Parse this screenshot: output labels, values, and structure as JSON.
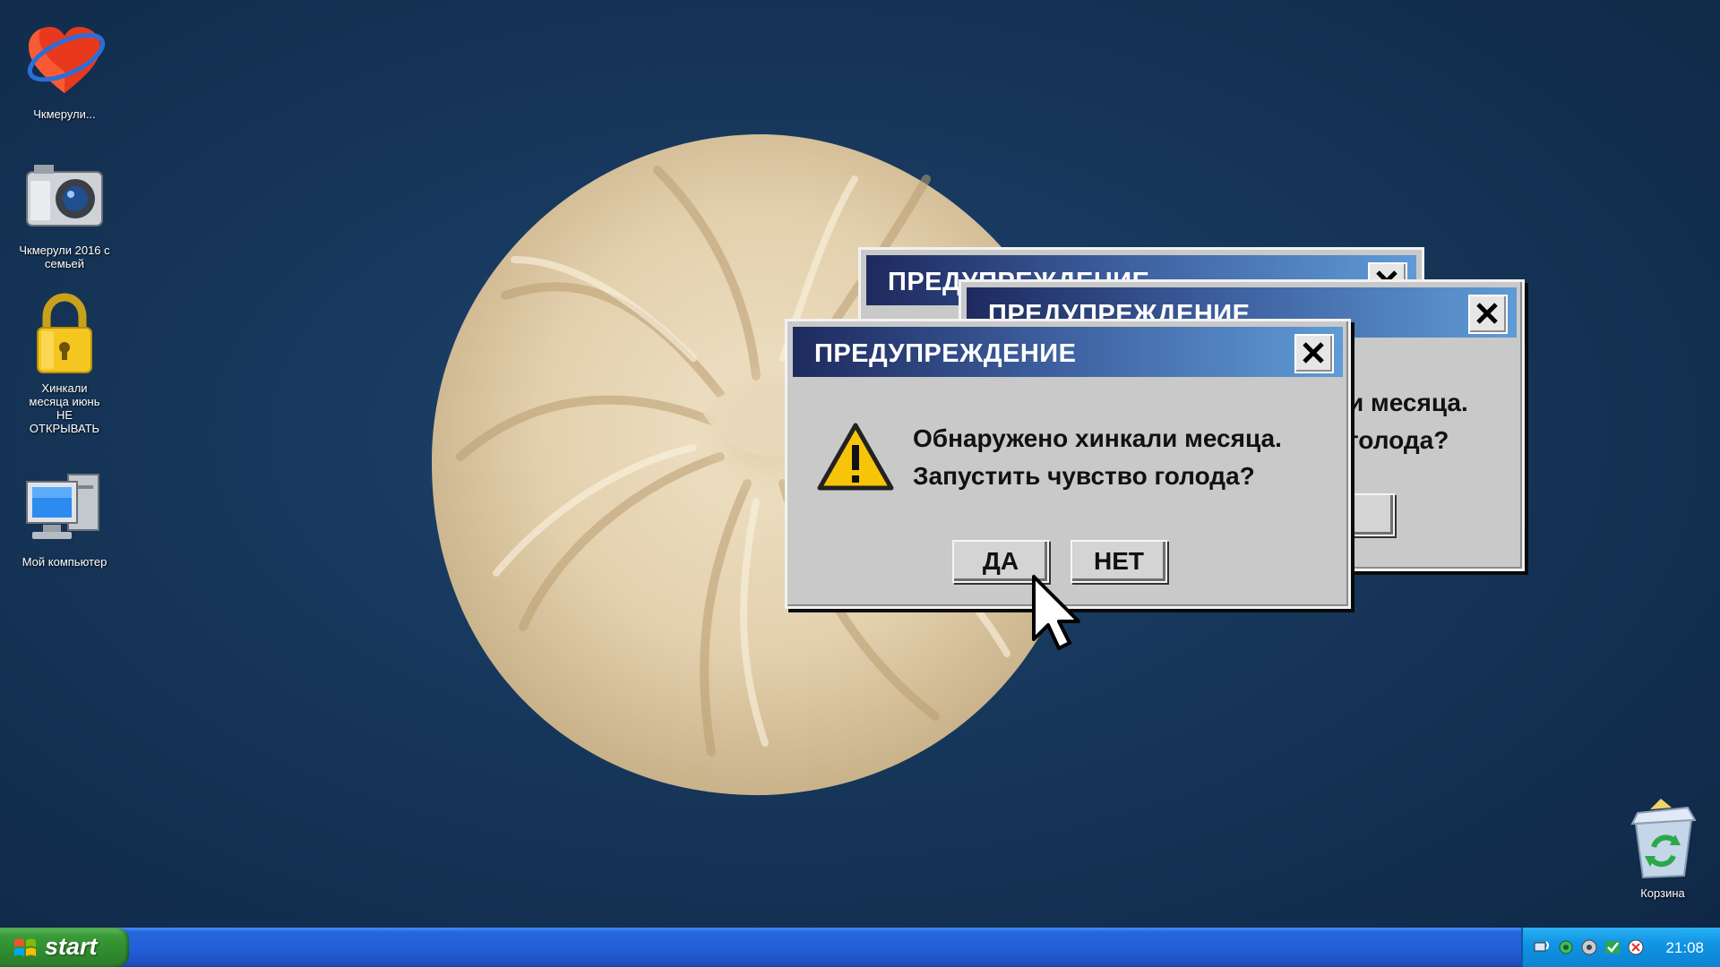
{
  "desktop": {
    "icons": [
      {
        "name": "chkmeruli-heart",
        "label": "Чкмерули..."
      },
      {
        "name": "chkmeruli-camera",
        "label": "Чкмерули 2016 с семьей"
      },
      {
        "name": "khinkali-lock",
        "label": "Хинкали месяца июнь НЕ ОТКРЫВАТЬ"
      },
      {
        "name": "my-computer",
        "label": "Мой компьютер"
      },
      {
        "name": "recycle-bin",
        "label": "Корзина"
      }
    ]
  },
  "dialogs": {
    "back": {
      "title": "ПРЕДУПРЕЖДЕНИЕ"
    },
    "middle": {
      "title": "ПРЕДУПРЕЖДЕНИЕ",
      "partial_line1": "и месяца.",
      "partial_line2": "голода?"
    },
    "front": {
      "title": "ПРЕДУПРЕЖДЕНИЕ",
      "message_line1": "Обнаружено хинкали месяца.",
      "message_line2": "Запустить чувство голода?",
      "yes_label": "ДА",
      "no_label": "НЕТ"
    }
  },
  "taskbar": {
    "start_label": "start",
    "clock": "21:08"
  },
  "colors": {
    "desktop": "#163659",
    "titlebar_start": "#1e2a5e",
    "titlebar_end": "#5f9bd6",
    "dialog_bg": "#c9c9c9",
    "taskbar": "#2360d8",
    "start_green": "#3a9b3a"
  }
}
